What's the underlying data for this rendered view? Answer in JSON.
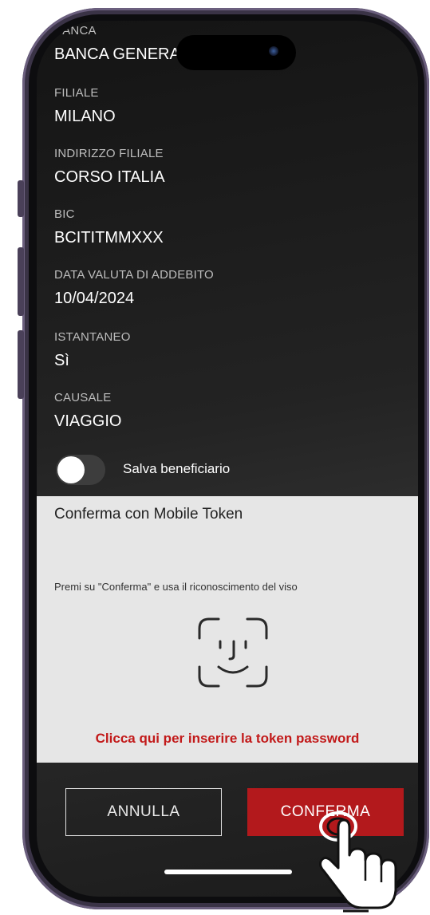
{
  "fields": [
    {
      "label": "BANCA",
      "value": "BANCA GENERALI"
    },
    {
      "label": "FILIALE",
      "value": "MILANO"
    },
    {
      "label": "INDIRIZZO FILIALE",
      "value": "CORSO ITALIA"
    },
    {
      "label": "BIC",
      "value": "BCITITMMXXX"
    },
    {
      "label": "DATA VALUTA DI ADDEBITO",
      "value": "10/04/2024"
    },
    {
      "label": "ISTANTANEO",
      "value": "Sì"
    },
    {
      "label": "CAUSALE",
      "value": "VIAGGIO"
    }
  ],
  "toggle": {
    "label": "Salva beneficiario",
    "state": "off"
  },
  "token": {
    "title": "Conferma con Mobile Token",
    "description": "Premi su \"Conferma\" e usa il riconoscimento del viso",
    "icon": "face-id-icon",
    "link": "Clicca qui per inserire la token password"
  },
  "actions": {
    "cancel": "ANNULLA",
    "confirm": "CONFERMA"
  },
  "colors": {
    "accent": "#b3191c",
    "link": "#c21a1a",
    "panel": "#e6e6e6"
  }
}
